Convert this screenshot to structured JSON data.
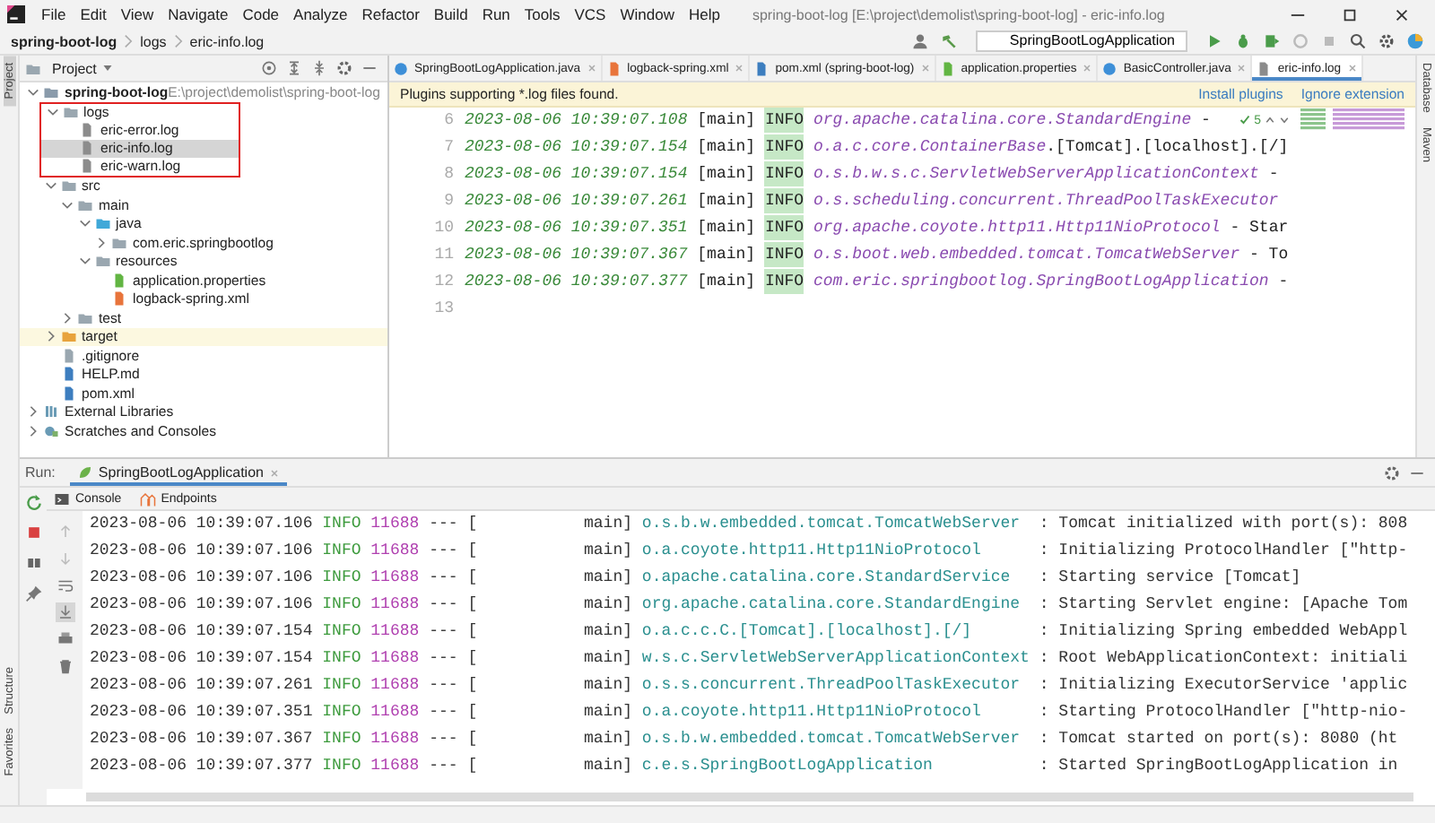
{
  "window": {
    "title": "spring-boot-log [E:\\project\\demolist\\spring-boot-log] - eric-info.log"
  },
  "menu": [
    "File",
    "Edit",
    "View",
    "Navigate",
    "Code",
    "Analyze",
    "Refactor",
    "Build",
    "Run",
    "Tools",
    "VCS",
    "Window",
    "Help"
  ],
  "breadcrumb": [
    "spring-boot-log",
    "logs",
    "eric-info.log"
  ],
  "run_configuration": "SpringBootLogApplication",
  "side_tabs_left": [
    {
      "label": "Project",
      "selected": true
    },
    {
      "label": "Structure",
      "selected": false
    },
    {
      "label": "Favorites",
      "selected": false
    }
  ],
  "side_tabs_right": [
    "Database",
    "Maven"
  ],
  "project_panel": {
    "title": "Project",
    "tree": [
      {
        "label": "spring-boot-log",
        "path": "E:\\project\\demolist\\spring-boot-log",
        "kind": "module",
        "expanded": true,
        "selected": false,
        "children": [
          {
            "label": "logs",
            "kind": "folder",
            "expanded": true,
            "selected": false,
            "outlined": true,
            "children": [
              {
                "label": "eric-error.log",
                "kind": "log",
                "selected": false
              },
              {
                "label": "eric-info.log",
                "kind": "log",
                "selected": true
              },
              {
                "label": "eric-warn.log",
                "kind": "log",
                "selected": false
              }
            ]
          },
          {
            "label": "src",
            "kind": "folder",
            "expanded": true,
            "selected": false,
            "children": [
              {
                "label": "main",
                "kind": "folder",
                "expanded": true,
                "selected": false,
                "children": [
                  {
                    "label": "java",
                    "kind": "source-folder",
                    "expanded": true,
                    "selected": false,
                    "children": [
                      {
                        "label": "com.eric.springbootlog",
                        "kind": "package",
                        "expanded": false,
                        "selected": false
                      }
                    ]
                  },
                  {
                    "label": "resources",
                    "kind": "resource-folder",
                    "expanded": true,
                    "selected": false,
                    "children": [
                      {
                        "label": "application.properties",
                        "kind": "properties",
                        "selected": false
                      },
                      {
                        "label": "logback-spring.xml",
                        "kind": "xml",
                        "selected": false
                      }
                    ]
                  }
                ]
              },
              {
                "label": "test",
                "kind": "folder",
                "expanded": false,
                "selected": false
              }
            ]
          },
          {
            "label": "target",
            "kind": "excluded-folder",
            "expanded": false,
            "selected": false
          },
          {
            "label": ".gitignore",
            "kind": "gitignore",
            "selected": false
          },
          {
            "label": "HELP.md",
            "kind": "markdown",
            "selected": false
          },
          {
            "label": "pom.xml",
            "kind": "maven",
            "selected": false
          }
        ]
      },
      {
        "label": "External Libraries",
        "kind": "library",
        "expanded": false,
        "selected": false
      },
      {
        "label": "Scratches and Consoles",
        "kind": "scratches",
        "expanded": false,
        "selected": false
      }
    ]
  },
  "editor": {
    "tabs": [
      {
        "label": "SpringBootLogApplication.java",
        "kind": "java",
        "selected": false
      },
      {
        "label": "logback-spring.xml",
        "kind": "xml",
        "selected": false
      },
      {
        "label": "pom.xml (spring-boot-log)",
        "kind": "maven",
        "selected": false
      },
      {
        "label": "application.properties",
        "kind": "properties",
        "selected": false
      },
      {
        "label": "BasicController.java",
        "kind": "java",
        "selected": false
      },
      {
        "label": "eric-info.log",
        "kind": "log",
        "selected": true
      }
    ],
    "notification": {
      "text": "Plugins supporting *.log files found.",
      "actions": [
        "Install plugins",
        "Ignore extension"
      ]
    },
    "inspection_count": "5",
    "line_numbers": [
      "6",
      "7",
      "8",
      "9",
      "10",
      "11",
      "12",
      "13"
    ],
    "lines": [
      {
        "time": "2023-08-06 10:39:07.108",
        "thread": "[main]",
        "log_level": "INFO",
        "logger": "org.apache.catalina.core.StandardEngine",
        "rest": " -"
      },
      {
        "time": "2023-08-06 10:39:07.154",
        "thread": "[main]",
        "log_level": "INFO",
        "logger": "o.a.c.core.ContainerBase",
        "rest": ".[Tomcat].[localhost].[/]"
      },
      {
        "time": "2023-08-06 10:39:07.154",
        "thread": "[main]",
        "log_level": "INFO",
        "logger": "o.s.b.w.s.c.ServletWebServerApplicationContext",
        "rest": " -"
      },
      {
        "time": "2023-08-06 10:39:07.261",
        "thread": "[main]",
        "log_level": "INFO",
        "logger": "o.s.scheduling.concurrent.ThreadPoolTaskExecutor"
      },
      {
        "time": "2023-08-06 10:39:07.351",
        "thread": "[main]",
        "log_level": "INFO",
        "logger": "org.apache.coyote.http11.Http11NioProtocol",
        "rest": " - Star"
      },
      {
        "time": "2023-08-06 10:39:07.367",
        "thread": "[main]",
        "log_level": "INFO",
        "logger": "o.s.boot.web.embedded.tomcat.TomcatWebServer",
        "rest": " - To"
      },
      {
        "time": "2023-08-06 10:39:07.377",
        "thread": "[main]",
        "log_level": "INFO",
        "logger": "com.eric.springbootlog.SpringBootLogApplication",
        "rest": " -"
      }
    ]
  },
  "run_panel": {
    "label": "Run:",
    "tabs": [
      {
        "label": "SpringBootLogApplication",
        "selected": true
      }
    ],
    "subtabs": [
      "Console",
      "Endpoints"
    ],
    "lines": [
      {
        "time": "2023-08-06 10:39:07.106",
        "log_level": "INFO",
        "pid": "11688",
        "separator": "---",
        "thread": "[           main]",
        "logger": "o.s.b.w.embedded.tomcat.TomcatWebServer",
        "message": ": Tomcat initialized with port(s): 808"
      },
      {
        "time": "2023-08-06 10:39:07.106",
        "log_level": "INFO",
        "pid": "11688",
        "separator": "---",
        "thread": "[           main]",
        "logger": "o.a.coyote.http11.Http11NioProtocol",
        "message": ": Initializing ProtocolHandler [\"http-"
      },
      {
        "time": "2023-08-06 10:39:07.106",
        "log_level": "INFO",
        "pid": "11688",
        "separator": "---",
        "thread": "[           main]",
        "logger": "o.apache.catalina.core.StandardService",
        "message": ": Starting service [Tomcat]"
      },
      {
        "time": "2023-08-06 10:39:07.106",
        "log_level": "INFO",
        "pid": "11688",
        "separator": "---",
        "thread": "[           main]",
        "logger": "org.apache.catalina.core.StandardEngine",
        "message": ": Starting Servlet engine: [Apache Tom"
      },
      {
        "time": "2023-08-06 10:39:07.154",
        "log_level": "INFO",
        "pid": "11688",
        "separator": "---",
        "thread": "[           main]",
        "logger": "o.a.c.c.C.[Tomcat].[localhost].[/]",
        "message": ": Initializing Spring embedded WebAppl"
      },
      {
        "time": "2023-08-06 10:39:07.154",
        "log_level": "INFO",
        "pid": "11688",
        "separator": "---",
        "thread": "[           main]",
        "logger": "w.s.c.ServletWebServerApplicationContext",
        "message": ": Root WebApplicationContext: initiali"
      },
      {
        "time": "2023-08-06 10:39:07.261",
        "log_level": "INFO",
        "pid": "11688",
        "separator": "---",
        "thread": "[           main]",
        "logger": "o.s.s.concurrent.ThreadPoolTaskExecutor",
        "message": ": Initializing ExecutorService 'applic"
      },
      {
        "time": "2023-08-06 10:39:07.351",
        "log_level": "INFO",
        "pid": "11688",
        "separator": "---",
        "thread": "[           main]",
        "logger": "o.a.coyote.http11.Http11NioProtocol",
        "message": ": Starting ProtocolHandler [\"http-nio-"
      },
      {
        "time": "2023-08-06 10:39:07.367",
        "log_level": "INFO",
        "pid": "11688",
        "separator": "---",
        "thread": "[           main]",
        "logger": "o.s.b.w.embedded.tomcat.TomcatWebServer",
        "message": ": Tomcat started on port(s): 8080 (ht"
      },
      {
        "time": "2023-08-06 10:39:07.377",
        "log_level": "INFO",
        "pid": "11688",
        "separator": "---",
        "thread": "[           main]",
        "logger": "c.e.s.SpringBootLogApplication",
        "message": ": Started SpringBootLogApplication in"
      }
    ]
  }
}
